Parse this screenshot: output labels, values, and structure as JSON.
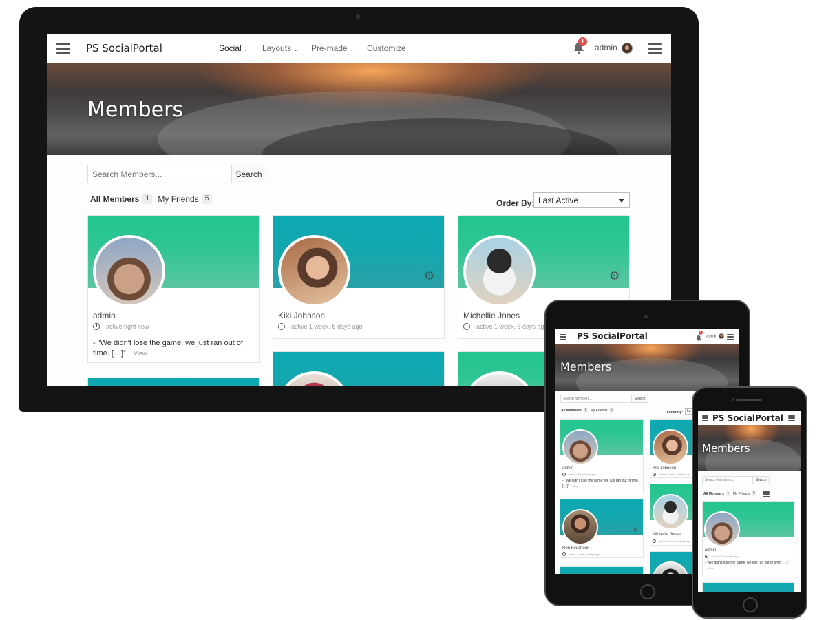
{
  "app": {
    "title": "PS SocialPortal"
  },
  "menu": [
    {
      "label": "Social",
      "has_dropdown": true
    },
    {
      "label": "Layouts",
      "has_dropdown": true
    },
    {
      "label": "Pre-made",
      "has_dropdown": true
    },
    {
      "label": "Customize",
      "has_dropdown": false
    }
  ],
  "notifications": {
    "count": "1"
  },
  "user": {
    "name": "admin"
  },
  "page": {
    "title": "Members"
  },
  "search": {
    "placeholder": "Search Members...",
    "button": "Search"
  },
  "tabs": [
    {
      "label": "All Members",
      "count": "1"
    },
    {
      "label": "My Friends",
      "count": "5"
    }
  ],
  "order": {
    "label": "Order By:",
    "value": "Last Active"
  },
  "members": [
    {
      "name": "admin",
      "activity": "active right now",
      "quote": "- \"We didn't lose the game; we just ran out of time. […]\"",
      "link": "View",
      "cover": "green",
      "has_gear": false
    },
    {
      "name": "Kiki Johnson",
      "activity": "active 1 week, 6 days ago",
      "cover": "teal",
      "has_gear": true
    },
    {
      "name": "Michellie Jones",
      "activity": "active 1 week, 6 days ago",
      "cover": "green",
      "has_gear": true
    }
  ],
  "tablet": {
    "members": [
      {
        "name": "admin",
        "activity": "active 47 seconds ago",
        "quote": "- \"We didn't lose the game; we just ran out of time. […]\"",
        "link": "View"
      },
      {
        "name": "Kiki Johnson",
        "activity": "active 1 week, 6 days ago"
      },
      {
        "name": "Ron Foucheux",
        "activity": "active 1 week, 6 days ago"
      },
      {
        "name": "Michellie Jones",
        "activity": "active 1 week, 6 days ago"
      }
    ],
    "order_value": "La"
  },
  "phone": {
    "members": [
      {
        "name": "admin",
        "activity": "active 47 seconds ago",
        "quote": "- \"We didn't lose the game; we just ran out of time. […]\"",
        "link": "View"
      }
    ]
  },
  "colors": {
    "cover_green": "#2fc594",
    "cover_teal": "#0da9b1",
    "badge": "#e44b4b",
    "device_frame": "#111111"
  },
  "icons": [
    "hamburger-icon",
    "chevron-down-icon",
    "bell-icon",
    "clock-icon",
    "gear-icon",
    "caret-down-icon",
    "list-view-icon"
  ]
}
